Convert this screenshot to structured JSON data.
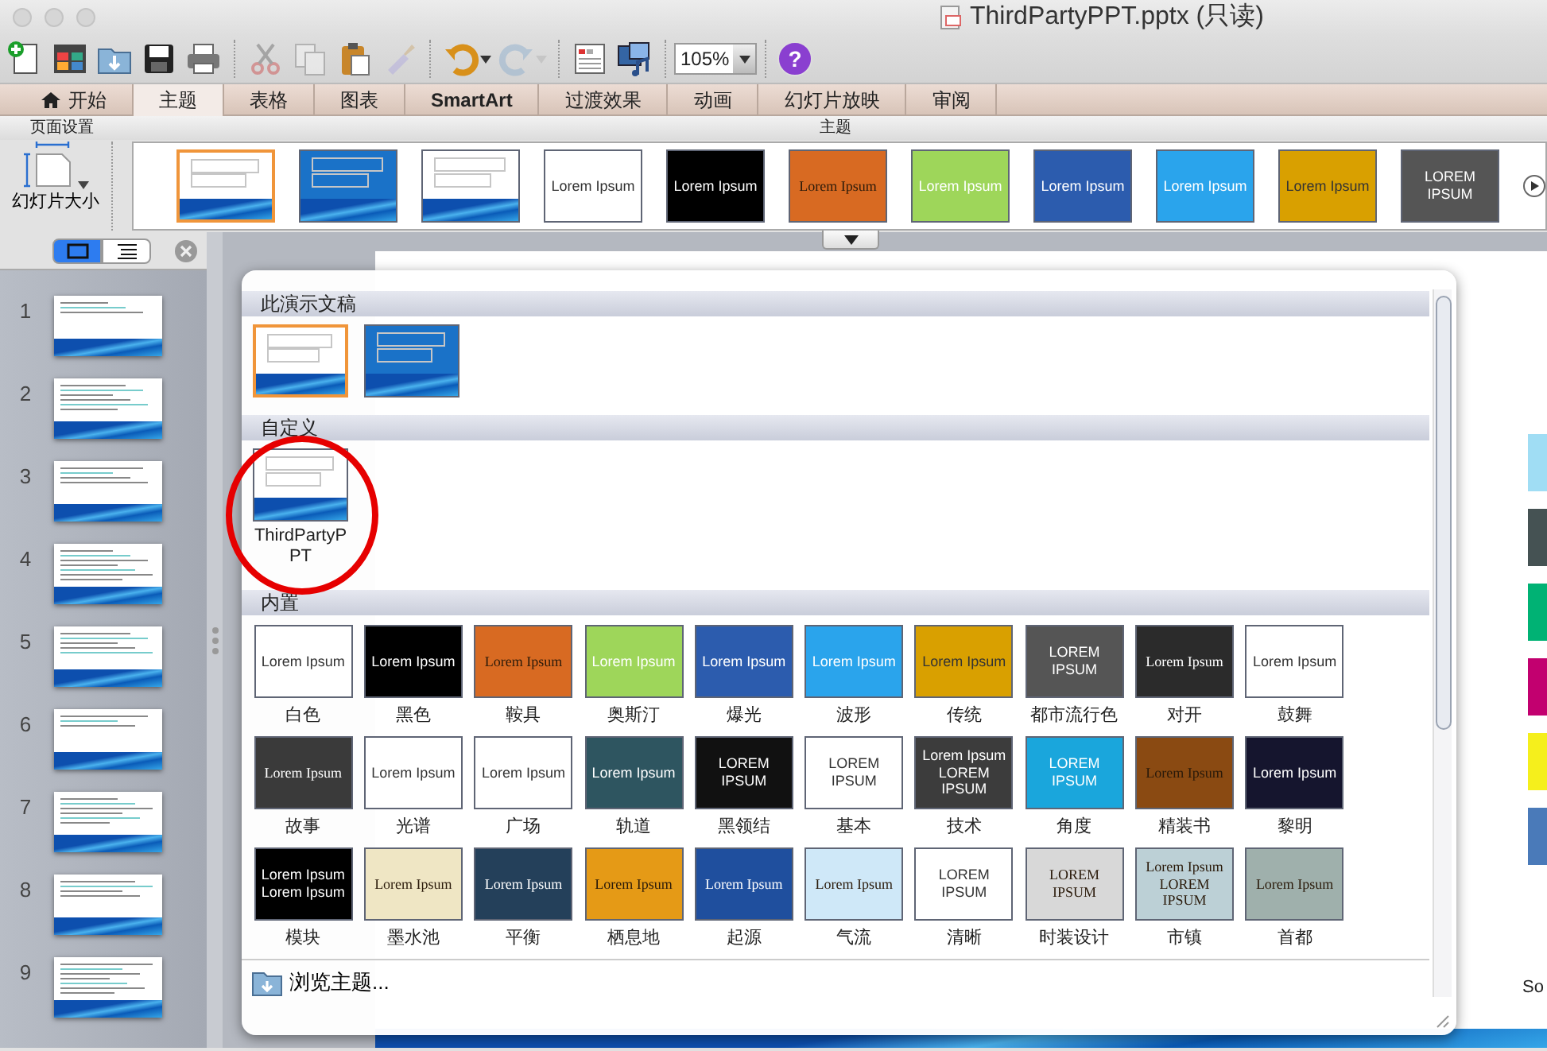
{
  "window": {
    "title": "ThirdPartyPPT.pptx (只读)"
  },
  "toolbar": {
    "groups": [
      [
        {
          "kind": "new",
          "disabled": false
        },
        {
          "kind": "gallery",
          "disabled": false
        },
        {
          "kind": "open",
          "disabled": false
        },
        {
          "kind": "save",
          "disabled": false
        },
        {
          "kind": "print",
          "disabled": false
        }
      ],
      [
        {
          "kind": "cut",
          "disabled": true
        },
        {
          "kind": "copy",
          "disabled": true
        },
        {
          "kind": "paste",
          "disabled": false
        },
        {
          "kind": "brush",
          "disabled": true
        }
      ],
      [
        {
          "kind": "undo",
          "disabled": false
        },
        {
          "kind": "redo",
          "disabled": true
        }
      ],
      [
        {
          "kind": "slides",
          "disabled": false
        },
        {
          "kind": "media",
          "disabled": false
        }
      ]
    ],
    "zoom": "105%",
    "help": "?"
  },
  "tabs": [
    {
      "label": "开始",
      "kind": "home",
      "selected": false
    },
    {
      "label": "主题",
      "selected": true
    },
    {
      "label": "表格",
      "selected": false
    },
    {
      "label": "图表",
      "selected": false
    },
    {
      "label": "SmartArt",
      "bold": true,
      "selected": false
    },
    {
      "label": "过渡效果",
      "selected": false
    },
    {
      "label": "动画",
      "selected": false
    },
    {
      "label": "幻灯片放映",
      "selected": false
    },
    {
      "label": "审阅",
      "selected": false
    }
  ],
  "ribbon": {
    "page_setup": {
      "title": "页面设置",
      "button": "幻灯片大小"
    },
    "themes": {
      "title": "主题",
      "items": [
        {
          "kind": "wave",
          "color": "#ffffff",
          "selected": true
        },
        {
          "kind": "wave",
          "color": "#1a72c8",
          "selected": false
        },
        {
          "kind": "wave",
          "color": "#ffffff",
          "selected": false
        },
        {
          "kind": "light",
          "color": "#ffffff",
          "preview": "Lorem Ipsum",
          "selected": false
        },
        {
          "kind": "dark",
          "color": "#000000",
          "preview": "Lorem Ipsum",
          "selected": false
        },
        {
          "kind": "serif",
          "color": "#d86a22",
          "preview": "Lorem Ipsum",
          "selected": false
        },
        {
          "kind": "dark",
          "color": "#9ed65a",
          "preview": "Lorem Ipsum",
          "selected": false
        },
        {
          "kind": "dark",
          "color": "#2c5cae",
          "preview": "Lorem Ipsum",
          "selected": false
        },
        {
          "kind": "dark",
          "color": "#2aa4ec",
          "preview": "Lorem Ipsum",
          "selected": false
        },
        {
          "kind": "light",
          "color": "#d9a000",
          "preview": "Lorem Ipsum",
          "selected": false
        },
        {
          "kind": "dark",
          "color": "#555555",
          "preview": "LOREM IPSUM",
          "selected": false
        }
      ]
    }
  },
  "view_modes": [
    {
      "kind": "normal",
      "selected": true
    },
    {
      "kind": "outline",
      "selected": false
    }
  ],
  "slides": [
    {
      "number": "1"
    },
    {
      "number": "2"
    },
    {
      "number": "3"
    },
    {
      "number": "4"
    },
    {
      "number": "5"
    },
    {
      "number": "6"
    },
    {
      "number": "7"
    },
    {
      "number": "8"
    },
    {
      "number": "9"
    }
  ],
  "slide": {
    "swatches": [
      {
        "color": "#a0ddf4"
      },
      {
        "color": "#455253"
      },
      {
        "color": "#00b274"
      },
      {
        "color": "#c2006f"
      },
      {
        "color": "#f5ef1c"
      },
      {
        "color": "#4a7ab9"
      }
    ],
    "caption": "So"
  },
  "theme_gallery": {
    "sections": [
      {
        "title": "此演示文稿",
        "items": [
          {
            "kind": "wave",
            "color": "#ffffff",
            "selected": true
          },
          {
            "kind": "wave",
            "color": "#1a72c8",
            "selected": false
          }
        ]
      },
      {
        "title": "自定义",
        "items": [
          {
            "kind": "wave",
            "color": "#ffffff",
            "caption": "ThirdPartyPPT",
            "selected": false,
            "circled": true
          }
        ]
      },
      {
        "title": "内置",
        "items": [
          {
            "kind": "light",
            "color": "#ffffff",
            "preview": "Lorem Ipsum",
            "caption": "白色",
            "selected": false
          },
          {
            "kind": "dark",
            "color": "#000000",
            "preview": "Lorem Ipsum",
            "caption": "黑色",
            "selected": false
          },
          {
            "kind": "serif",
            "color": "#d86a22",
            "preview": "Lorem Ipsum",
            "caption": "鞍具",
            "selected": false
          },
          {
            "kind": "dark",
            "color": "#9ed65a",
            "preview": "Lorem Ipsum",
            "caption": "奥斯汀",
            "selected": false
          },
          {
            "kind": "dark",
            "color": "#2c5cae",
            "preview": "Lorem Ipsum",
            "caption": "爆光",
            "selected": false
          },
          {
            "kind": "dark",
            "color": "#2aa4ec",
            "preview": "Lorem Ipsum",
            "caption": "波形",
            "selected": false
          },
          {
            "kind": "light",
            "color": "#d9a000",
            "preview": "Lorem Ipsum",
            "caption": "传统",
            "selected": false
          },
          {
            "kind": "dark",
            "color": "#555555",
            "preview": "LOREM IPSUM",
            "caption": "都市流行色",
            "selected": false
          },
          {
            "kind": "serif",
            "color": "#2b2b2b",
            "preview": "Lorem Ipsum",
            "caption": "对开",
            "selected": false
          },
          {
            "kind": "light",
            "color": "#ffffff",
            "preview": "Lorem Ipsum",
            "caption": "鼓舞",
            "selected": false
          },
          {
            "kind": "serif",
            "color": "#3a3a3a",
            "preview": "Lorem Ipsum",
            "caption": "故事",
            "selected": false
          },
          {
            "kind": "light",
            "color": "#ffffff",
            "preview": "Lorem Ipsum",
            "caption": "光谱",
            "selected": false
          },
          {
            "kind": "light",
            "color": "#ffffff",
            "preview": "Lorem Ipsum",
            "caption": "广场",
            "selected": false
          },
          {
            "kind": "dark",
            "color": "#2e5560",
            "preview": "Lorem Ipsum",
            "caption": "轨道",
            "selected": false
          },
          {
            "kind": "dark",
            "color": "#111111",
            "preview": "LOREM IPSUM",
            "caption": "黑领结",
            "selected": false
          },
          {
            "kind": "light",
            "color": "#ffffff",
            "preview": "LOREM IPSUM",
            "caption": "基本",
            "selected": false
          },
          {
            "kind": "dark",
            "color": "#3c3c3c",
            "preview": "Lorem Ipsum",
            "sub": "LOREM IPSUM",
            "caption": "技术",
            "selected": false
          },
          {
            "kind": "dark",
            "color": "#1aa6dc",
            "preview": "LOREM IPSUM",
            "caption": "角度",
            "selected": false
          },
          {
            "kind": "serif",
            "color": "#8a4a12",
            "preview": "Lorem Ipsum",
            "caption": "精装书",
            "selected": false
          },
          {
            "kind": "dark",
            "color": "#15152e",
            "preview": "Lorem Ipsum",
            "caption": "黎明",
            "selected": false
          },
          {
            "kind": "dark",
            "color": "#000000",
            "preview": "Lorem Ipsum",
            "sub": "Lorem Ipsum",
            "caption": "模块",
            "selected": false
          },
          {
            "kind": "serif",
            "color": "#efe6c4",
            "preview": "Lorem Ipsum",
            "caption": "墨水池",
            "selected": false
          },
          {
            "kind": "serif",
            "color": "#24405a",
            "preview": "Lorem Ipsum",
            "caption": "平衡",
            "selected": false
          },
          {
            "kind": "serif",
            "color": "#e59a16",
            "preview": "Lorem Ipsum",
            "caption": "栖息地",
            "selected": false
          },
          {
            "kind": "serif",
            "color": "#1f4f9e",
            "preview": "Lorem Ipsum",
            "caption": "起源",
            "selected": false
          },
          {
            "kind": "serif",
            "color": "#cfe8f8",
            "preview": "Lorem Ipsum",
            "caption": "气流",
            "selected": false
          },
          {
            "kind": "light",
            "color": "#ffffff",
            "preview": "LOREM IPSUM",
            "caption": "清晰",
            "selected": false
          },
          {
            "kind": "serif",
            "color": "#d8d8d8",
            "preview": "LOREM IPSUM",
            "caption": "时装设计",
            "selected": false
          },
          {
            "kind": "serif",
            "color": "#bcd0d6",
            "preview": "Lorem Ipsum",
            "sub": "LOREM IPSUM",
            "caption": "市镇",
            "selected": false
          },
          {
            "kind": "serif",
            "color": "#9fb0ac",
            "preview": "Lorem Ipsum",
            "caption": "首都",
            "selected": false
          }
        ]
      }
    ],
    "browse": "浏览主题..."
  }
}
